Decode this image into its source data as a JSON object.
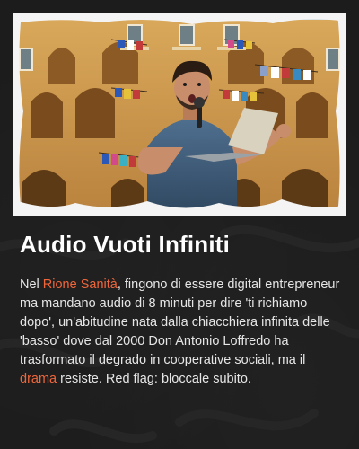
{
  "headline": "Audio Vuoti Infiniti",
  "body": {
    "part1": "Nel ",
    "link1": "Rione Sanità",
    "part2": ", fingono di essere digital entrepreneur ma mandano audio di 8 minuti per dire 'ti richiamo dopo', un'abitudine nata dalla chiacchiera infinita delle 'basso' dove dal 2000 Don Antonio Loffredo ha trasformato il degrado in cooperative sociali, ma il ",
    "link2": "drama",
    "part3": " resiste. Red flag: bloccale subito."
  },
  "colors": {
    "background": "#1c1c1c",
    "headline": "#ffffff",
    "body": "#e6e6e6",
    "highlight": "#f0663a"
  },
  "image": {
    "subject": "man with microphone and laptop in front of yellow Naples courtyard building with laundry lines"
  }
}
